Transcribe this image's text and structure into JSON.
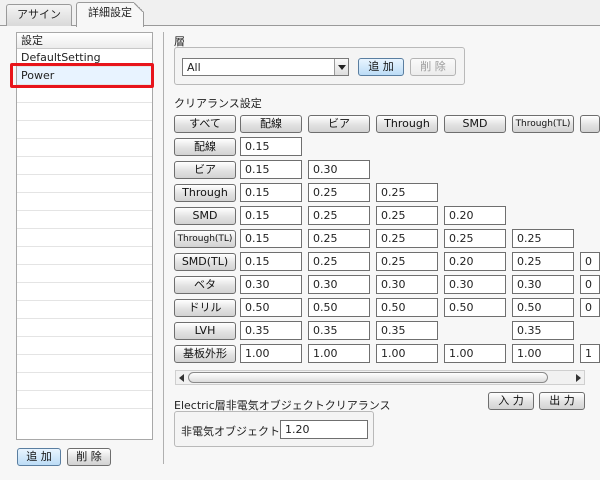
{
  "tabs": [
    {
      "label": "アサイン",
      "active": false
    },
    {
      "label": "詳細設定",
      "active": true
    }
  ],
  "settings_list": {
    "header": "設定",
    "items": [
      "DefaultSetting",
      "Power"
    ],
    "selected": "Power",
    "add_label": "追 加",
    "delete_label": "削 除"
  },
  "layer": {
    "title": "層",
    "selected": "All",
    "add_label": "追 加",
    "delete_label": "削 除"
  },
  "clearance": {
    "title": "クリアランス設定",
    "all_label": "すべて",
    "columns": [
      "配線",
      "ビア",
      "Through",
      "SMD",
      "Through(TL)"
    ],
    "rows": [
      {
        "label": "配線",
        "values": [
          "0.15"
        ]
      },
      {
        "label": "ビア",
        "values": [
          "0.15",
          "0.30"
        ]
      },
      {
        "label": "Through",
        "values": [
          "0.15",
          "0.25",
          "0.25"
        ]
      },
      {
        "label": "SMD",
        "values": [
          "0.15",
          "0.25",
          "0.25",
          "0.20"
        ]
      },
      {
        "label": "Through(TL)",
        "values": [
          "0.15",
          "0.25",
          "0.25",
          "0.25",
          "0.25"
        ]
      },
      {
        "label": "SMD(TL)",
        "values": [
          "0.15",
          "0.25",
          "0.25",
          "0.20",
          "0.25",
          "0"
        ]
      },
      {
        "label": "ベタ",
        "values": [
          "0.30",
          "0.30",
          "0.30",
          "0.30",
          "0.30",
          "0"
        ]
      },
      {
        "label": "ドリル",
        "values": [
          "0.50",
          "0.50",
          "0.50",
          "0.50",
          "0.50",
          "0"
        ]
      },
      {
        "label": "LVH",
        "values": [
          "0.35",
          "0.35",
          "0.35",
          "",
          "0.35",
          ""
        ]
      },
      {
        "label": "基板外形",
        "values": [
          "1.00",
          "1.00",
          "1.00",
          "1.00",
          "1.00",
          "1"
        ]
      }
    ],
    "input_label": "入 力",
    "output_label": "出 力"
  },
  "electric": {
    "title": "Electric層非電気オブジェクトクリアランス",
    "label": "非電気オブジェクト",
    "value": "1.20"
  },
  "colors": {
    "highlight": "#e8141b",
    "selected_row": "#e8f3ff"
  }
}
